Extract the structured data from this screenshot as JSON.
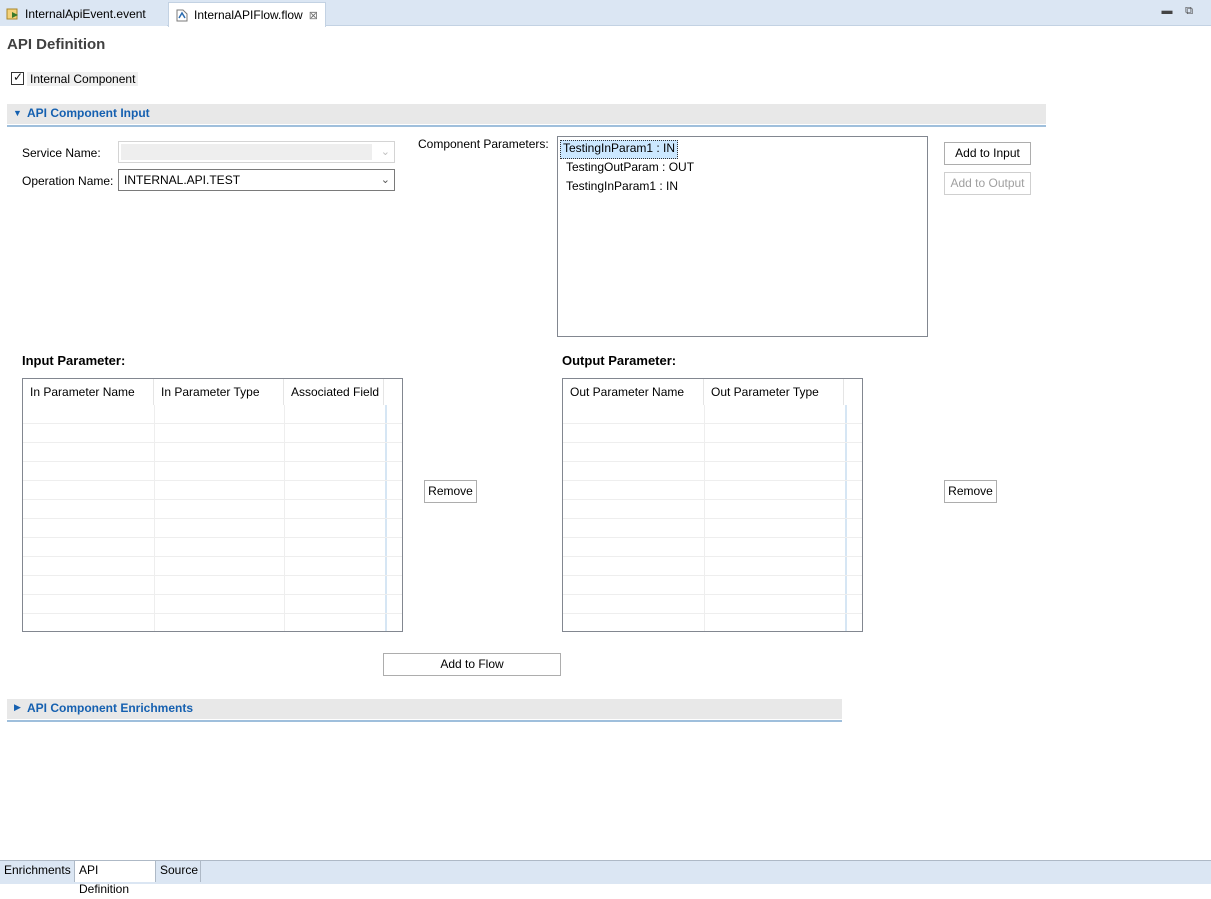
{
  "editor_tabs": [
    {
      "label": "InternalApiEvent.event",
      "icon": "event-file-icon",
      "active": false
    },
    {
      "label": "InternalAPIFlow.flow",
      "icon": "flow-file-icon",
      "active": true
    }
  ],
  "window_controls": {
    "minimize_icon": "minimize-icon",
    "restore_icon": "restore-icon"
  },
  "page": {
    "title": "API Definition",
    "internal_component": {
      "label": "Internal Component",
      "checked": true
    }
  },
  "input_section": {
    "title": "API Component Input",
    "expanded": true,
    "service_name_label": "Service Name:",
    "service_name_value": "",
    "operation_name_label": "Operation Name:",
    "operation_name_value": "INTERNAL.API.TEST",
    "component_params_label": "Component Parameters:",
    "component_params": [
      "TestingInParam1 : IN",
      "TestingOutParam : OUT",
      "TestingInParam1 : IN"
    ],
    "add_to_input_label": "Add to Input",
    "add_to_output_label": "Add to Output"
  },
  "input_parameter": {
    "heading": "Input Parameter:",
    "columns": [
      "In Parameter Name",
      "In Parameter Type",
      "Associated Field"
    ],
    "remove_label": "Remove"
  },
  "output_parameter": {
    "heading": "Output Parameter:",
    "columns": [
      "Out Parameter Name",
      "Out Parameter Type"
    ],
    "remove_label": "Remove"
  },
  "add_to_flow_label": "Add to Flow",
  "enrichments_section": {
    "title": "API Component Enrichments",
    "expanded": false
  },
  "bottom_tabs": [
    {
      "label": "Enrichments",
      "active": false
    },
    {
      "label": "API Definition",
      "active": true
    },
    {
      "label": "Source",
      "active": false
    }
  ]
}
